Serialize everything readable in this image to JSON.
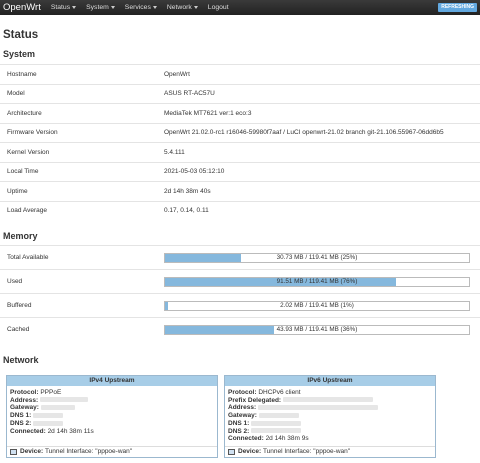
{
  "header": {
    "brand": "OpenWrt",
    "menu": [
      "Status",
      "System",
      "Services",
      "Network",
      "Logout"
    ],
    "refresh_badge": "REFRESHING"
  },
  "page_title": "Status",
  "system": {
    "title": "System",
    "rows": [
      {
        "label": "Hostname",
        "value": "OpenWrt"
      },
      {
        "label": "Model",
        "value": "ASUS RT-AC57U"
      },
      {
        "label": "Architecture",
        "value": "MediaTek MT7621 ver:1 eco:3"
      },
      {
        "label": "Firmware Version",
        "value": "OpenWrt 21.02.0-rc1 r16046-59980f7aaf / LuCI openwrt-21.02 branch git-21.106.55967-06dd6b5"
      },
      {
        "label": "Kernel Version",
        "value": "5.4.111"
      },
      {
        "label": "Local Time",
        "value": "2021-05-03 05:12:10"
      },
      {
        "label": "Uptime",
        "value": "2d 14h 38m 40s"
      },
      {
        "label": "Load Average",
        "value": "0.17, 0.14, 0.11"
      }
    ]
  },
  "memory": {
    "title": "Memory",
    "rows": [
      {
        "label": "Total Available",
        "text": "30.73 MB / 119.41 MB (25%)",
        "fraction": 0.25
      },
      {
        "label": "Used",
        "text": "91.51 MB / 119.41 MB (76%)",
        "fraction": 0.76
      },
      {
        "label": "Buffered",
        "text": "2.02 MB / 119.41 MB (1%)",
        "fraction": 0.01
      },
      {
        "label": "Cached",
        "text": "43.93 MB / 119.41 MB (36%)",
        "fraction": 0.36
      }
    ]
  },
  "network": {
    "title": "Network",
    "ipv4": {
      "title": "IPv4 Upstream",
      "protocol_label": "Protocol:",
      "protocol": "PPPoE",
      "address_label": "Address:",
      "gateway_label": "Gateway:",
      "dns1_label": "DNS 1:",
      "dns2_label": "DNS 2:",
      "connected_label": "Connected:",
      "connected": "2d 14h 38m 11s",
      "device_label": "Device:",
      "device": "Tunnel Interface: \"pppoe-wan\""
    },
    "ipv6": {
      "title": "IPv6 Upstream",
      "protocol_label": "Protocol:",
      "protocol": "DHCPv6 client",
      "prefix_label": "Prefix Delegated:",
      "address_label": "Address:",
      "gateway_label": "Gateway:",
      "dns1_label": "DNS 1:",
      "dns2_label": "DNS 2:",
      "connected_label": "Connected:",
      "connected": "2d 14h 38m 9s",
      "device_label": "Device:",
      "device": "Tunnel Interface: \"pppoe-wan\""
    }
  }
}
